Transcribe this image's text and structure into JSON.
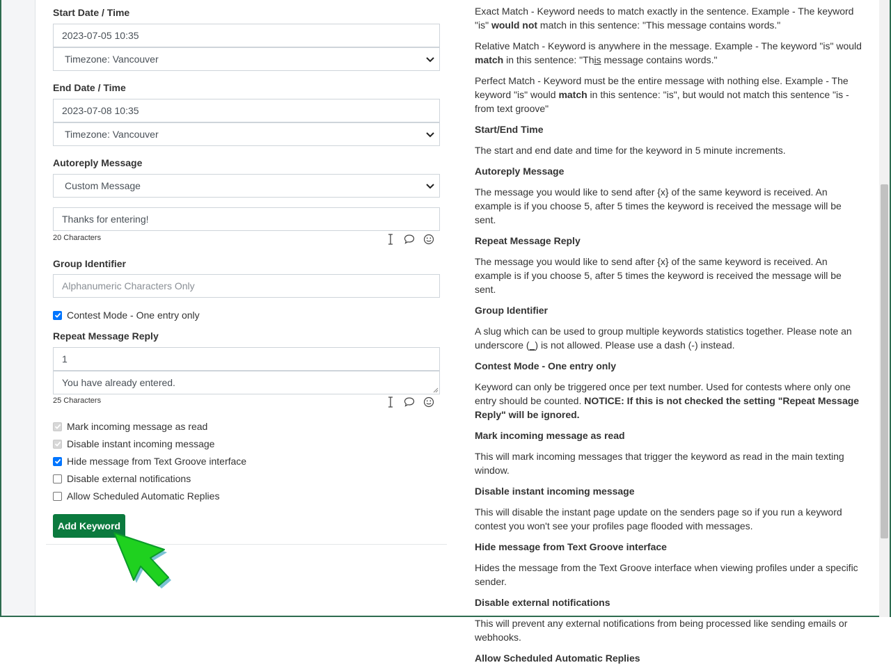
{
  "form": {
    "start": {
      "label": "Start Date / Time",
      "value": "2023-07-05 10:35",
      "timezone": "Timezone: Vancouver"
    },
    "end": {
      "label": "End Date / Time",
      "value": "2023-07-08 10:35",
      "timezone": "Timezone: Vancouver"
    },
    "autoreply": {
      "label": "Autoreply Message",
      "selected": "Custom Message",
      "message": "Thanks for entering!",
      "counter": "20 Characters"
    },
    "group": {
      "label": "Group Identifier",
      "placeholder": "Alphanumeric Characters Only"
    },
    "contest": {
      "label": "Contest Mode - One entry only",
      "checked": true
    },
    "repeat": {
      "label": "Repeat Message Reply",
      "count": "1",
      "message": "You have already entered.",
      "counter": "25 Characters"
    },
    "options": [
      {
        "label": "Mark incoming message as read",
        "state": "disabled-checked"
      },
      {
        "label": "Disable instant incoming message",
        "state": "disabled-checked"
      },
      {
        "label": "Hide message from Text Groove interface",
        "state": "checked"
      },
      {
        "label": "Disable external notifications",
        "state": "unchecked"
      },
      {
        "label": "Allow Scheduled Automatic Replies",
        "state": "unchecked"
      }
    ],
    "submit_label": "Add Keyword"
  },
  "help": {
    "exact": {
      "pre": "Exact Match - Keyword needs to match exactly in the sentence. Example - The keyword \"is\" ",
      "bold": "would not",
      "post": " match in this sentence: \"This message contains words.\""
    },
    "relative": {
      "pre": "Relative Match - Keyword is anywhere in the message. Example - The keyword \"is\" would ",
      "bold": "match",
      "mid": " in this sentence: \"Th",
      "underlined": "is",
      "post": " message contains words.\""
    },
    "perfect": {
      "pre": "Perfect Match - Keyword must be the entire message with nothing else. Example - The keyword \"is\" would ",
      "bold": "match",
      "post": " in this sentence: \"is\", but would not match this sentence \"is - from text groove\""
    },
    "start_end": {
      "title": "Start/End Time",
      "text": "The start and end date and time for the keyword in 5 minute increments."
    },
    "autoreply": {
      "title": "Autoreply Message",
      "text": "The message you would like to send after {x} of the same keyword is received. An example is if you choose 5, after 5 times the keyword is received the message will be sent."
    },
    "repeat": {
      "title": "Repeat Message Reply",
      "text": "The message you would like to send after {x} of the same keyword is received. An example is if you choose 5, after 5 times the keyword is received the message will be sent."
    },
    "group": {
      "title": "Group Identifier",
      "pre": "A slug which can be used to group multiple keywords statistics together. Please note an underscore (",
      "underlined": "_",
      "post": ") is not allowed. Please use a dash (-) instead."
    },
    "contest": {
      "title": "Contest Mode - One entry only",
      "text": "Keyword can only be triggered once per text number. Used for contests where only one entry should be counted. ",
      "bold": "NOTICE: If this is not checked the setting \"Repeat Message Reply\" will be ignored."
    },
    "mark_read": {
      "title": "Mark incoming message as read",
      "text": "This will mark incoming messages that trigger the keyword as read in the main texting window."
    },
    "disable_instant": {
      "title": "Disable instant incoming message",
      "text": "This will disable the instant page update on the senders page so if you run a keyword contest you won't see your profiles page flooded with messages."
    },
    "hide": {
      "title": "Hide message from Text Groove interface",
      "text": "Hides the message from the Text Groove interface when viewing profiles under a specific sender."
    },
    "disable_ext": {
      "title": "Disable external notifications",
      "text": "This will prevent any external notifications from being processed like sending emails or webhooks."
    },
    "scheduled": {
      "title": "Allow Scheduled Automatic Replies"
    }
  },
  "colors": {
    "primary_button": "#0b7a3e",
    "checkbox_checked": "#0075ff",
    "cursor": "#1fd11f"
  }
}
